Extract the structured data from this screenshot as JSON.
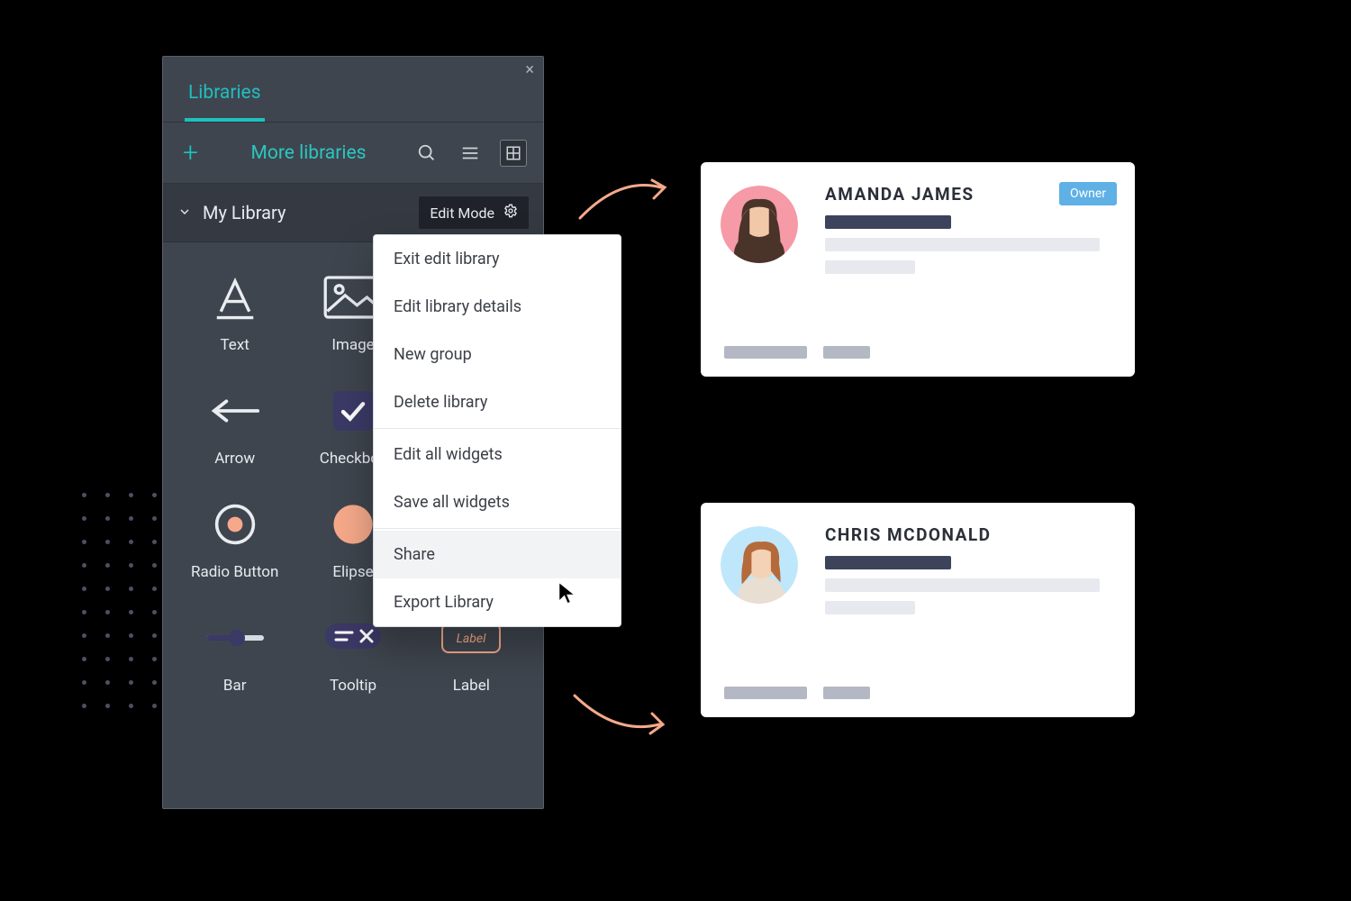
{
  "panel": {
    "tab_label": "Libraries",
    "more_link": "More libraries",
    "library_row": {
      "title": "My Library",
      "edit_mode_label": "Edit Mode"
    },
    "widgets": [
      {
        "label": "Text"
      },
      {
        "label": "Image"
      },
      {
        "label": ""
      },
      {
        "label": "Arrow"
      },
      {
        "label": "Checkbox"
      },
      {
        "label": ""
      },
      {
        "label": "Radio Button"
      },
      {
        "label": "Elipse"
      },
      {
        "label": ""
      },
      {
        "label": "Bar"
      },
      {
        "label": "Tooltip"
      },
      {
        "label": "Label"
      }
    ]
  },
  "menu": {
    "items": [
      "Exit edit library",
      "Edit library details",
      "New group",
      "Delete library",
      "Edit all widgets",
      "Save all widgets",
      "Share",
      "Export Library"
    ],
    "hover_index": 6
  },
  "cards": [
    {
      "name": "AMANDA JAMES",
      "badge": "Owner"
    },
    {
      "name": "CHRIS MCDONALD",
      "badge": null
    }
  ],
  "colors": {
    "teal": "#1fbfbf",
    "peach": "#f6a98a",
    "badge_blue": "#5fb0e5",
    "pink": "#f59aa6",
    "sky": "#bfe7fb",
    "slate": "#3c435b"
  }
}
